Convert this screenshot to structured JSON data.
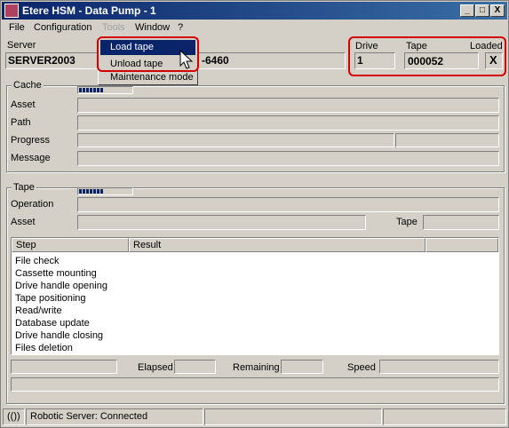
{
  "window": {
    "title": "Etere HSM - Data Pump - 1",
    "minimize": "_",
    "maximize": "□",
    "close": "X"
  },
  "menu": {
    "file": "File",
    "configuration": "Configuration",
    "tools": "Tools",
    "window": "Window",
    "help": "?"
  },
  "tools_menu": {
    "items": [
      "Load tape",
      "Unload tape",
      "Maintenance mode"
    ],
    "selected": "Load tape"
  },
  "server": {
    "label": "Server",
    "value": "SERVER2003",
    "partial_value": "-6460"
  },
  "drive_info": {
    "drive_label": "Drive",
    "drive_value": "1",
    "tape_label": "Tape",
    "tape_value": "000052",
    "loaded_label": "Loaded",
    "loaded_value": "X"
  },
  "cache": {
    "title": "Cache",
    "asset_label": "Asset",
    "path_label": "Path",
    "progress_label": "Progress",
    "message_label": "Message"
  },
  "tape_group": {
    "title": "Tape",
    "operation_label": "Operation",
    "asset_label": "Asset",
    "tape_label": "Tape"
  },
  "steps_table": {
    "columns": [
      "Step",
      "Result"
    ],
    "rows": [
      "File check",
      "Cassette mounting",
      "Drive handle opening",
      "Tape positioning",
      "Read/write",
      "Database update",
      "Drive handle closing",
      "Files deletion"
    ]
  },
  "timing": {
    "elapsed_label": "Elapsed",
    "remaining_label": "Remaining",
    "speed_label": "Speed"
  },
  "statusbar": {
    "indicator": "(())",
    "status_text": "Robotic Server: Connected"
  },
  "colors": {
    "titlebar": "#0a246a",
    "highlight": "#d40000",
    "window_bg": "#d4d0c8"
  }
}
